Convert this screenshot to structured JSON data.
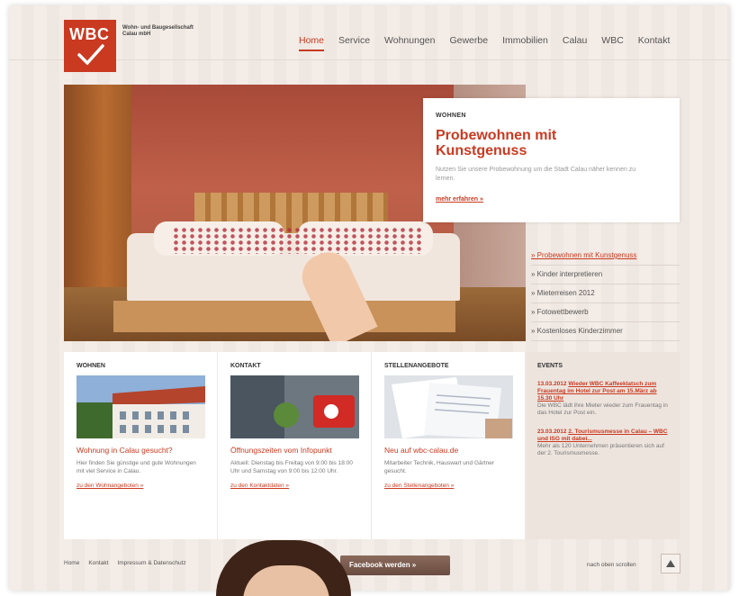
{
  "brand": {
    "logo_text": "WBC",
    "company_line1": "Wohn- und Baugesellschaft",
    "company_line2": "Calau mbH",
    "accent": "#c93a21"
  },
  "nav": {
    "items": [
      "Home",
      "Service",
      "Wohnungen",
      "Gewerbe",
      "Immobilien",
      "Calau",
      "WBC",
      "Kontakt"
    ],
    "active": "Home"
  },
  "hero": {
    "kicker": "WOHNEN",
    "title": "Probewohnen mit Kunstgenuss",
    "text": "Nutzen Sie unsere Probewohnung um die Stadt Calau näher kennen zu lernen.",
    "link": "mehr erfahren »"
  },
  "side_links": [
    "» Probewohnen mit Kunstgenuss",
    "» Kinder interpretieren",
    "» Mieterreisen 2012",
    "» Fotowettbewerb",
    "» Kostenloses Kinderzimmer"
  ],
  "boxes": [
    {
      "title": "WOHNEN",
      "image_icon": "house-photo",
      "head": "Wohnung in Calau gesucht?",
      "text": "Hier finden Sie günstige und gute Wohnungen mit viel Service in Calau.",
      "link": "zu den Wohnangeboten »"
    },
    {
      "title": "KONTAKT",
      "image_icon": "mailbox-photo",
      "head": "Öffnungszeiten vom Infopunkt",
      "text": "Aktuell: Dienstag bis Freitag von 9:00 bis 18:00 Uhr und Samstag von 9:00 bis 12:00 Uhr.",
      "link": "zu den Kontaktdaten »"
    },
    {
      "title": "STELLENANGEBOTE",
      "image_icon": "documents-photo",
      "head": "Neu auf wbc-calau.de",
      "text": "Mitarbeiter Technik, Hauswart und Gärtner gesucht.",
      "link": "zu den Stellenangeboten »"
    }
  ],
  "events": {
    "title": "EVENTS",
    "items": [
      {
        "date": "13.03.2012",
        "title": "Wieder WBC Kaffeeklatsch zum Frauentag im Hotel zur Post am 15.März ab 15.30 Uhr",
        "text": "Die WBC lädt ihre Mieter wieder zum Frauentag in das Hotel zur Post ein."
      },
      {
        "date": "23.03.2012",
        "title": "2. Tourismusmesse in Calau – WBC und ISG mit dabei...",
        "text": "Mehr als 120 Unternehmen präsentieren sich auf der 2. Tourismusmesse."
      }
    ]
  },
  "footer": {
    "links": [
      "Home",
      "Kontakt",
      "Impressum & Datenschutz"
    ],
    "facebook_button": "Facebook werden »",
    "scroll_label": "nach oben scrollen"
  }
}
